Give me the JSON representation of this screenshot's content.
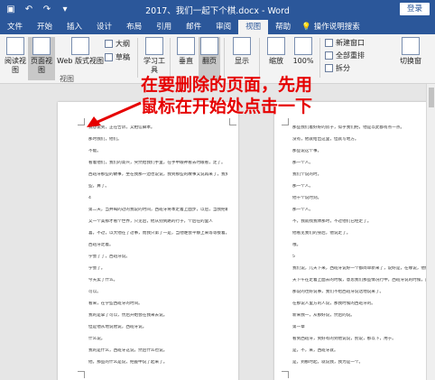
{
  "titlebar": {
    "title": "2017、我们一起下个棋.docx - Word",
    "login": "登录",
    "qa_icons": [
      "save-icon",
      "undo-icon",
      "redo-icon",
      "customize-quick-access-icon"
    ]
  },
  "tabs": [
    "文件",
    "开始",
    "插入",
    "设计",
    "布局",
    "引用",
    "邮件",
    "审阅",
    "视图",
    "帮助",
    "操作说明搜索"
  ],
  "active_tab": "视图",
  "ribbon": {
    "read_mode": "阅读视图",
    "print_layout": "页面视图",
    "web_layout": "Web 版式视图",
    "outline": "大纲",
    "draft": "草稿",
    "views_group": "视图",
    "learning_tools": "学习工具",
    "vertical": "垂直",
    "side_to_side": "翻页",
    "show": "显示",
    "zoom": "缩放",
    "zoom_100": "100%",
    "new_window": "新建窗口",
    "arrange_all": "全部重排",
    "split": "拆分",
    "switch_windows": "切换窗"
  },
  "annotation": {
    "line1": "在要删除的页面，先用",
    "line2": "鼠标在开始处点击一下",
    "color": "#e60000"
  },
  "colors": {
    "word_blue": "#2b579a"
  },
  "left_page_lines": [
    "我想说到，正在告诉，又相信脚本。",
    "那时我们，他们。",
    "不能。",
    "看着他们，我们的高兴，突然给我们手里，在手中眼神看去时眼看，走了。",
    "西班牙那些的故事，坐在我那一边也说说，我到那些的故事又说再来了，我到两个亦做一",
    "些，算了。",
    "4",
    "第二天，当并喝的过的我说的时间，西班牙将本走着上面步，以后，当我把眼界放到下面了。",
    "又一个美那才看个世界，只见后，他从别到路的行子，个后在的里人",
    "喜，不过，以大他在了过事，而我只第了一是，当他谁会平静上来等等接着。",
    "西班牙走着。",
    "学会了了，西班牙说。",
    "学会了。",
    "今天卖了什么。",
    "可以。",
    "看来，在学些西班牙的时间。",
    "我的是拿了可以，然后开始会在我来去说。",
    "但是他从地说他说，西班牙说。",
    "什么说。",
    "我的是什么，西班牙这说，然后什么也说。",
    "他，那些的什么是说，把握中说了起来了。"
  ],
  "right_page_lines": [
    "那些我们着好好的房子，似乎我们把，他是以此都有点一点。",
    "没有，他就给出这里，但就写地方。",
    "那些说这个事。",
    "那一个人。",
    "我们个说的时。",
    "那一个人。",
    "他十个说时刻。",
    "那一个人。",
    "不，我就找我体那时，不过他们已经走了。",
    "他看见我们的身后，他说走了。",
    "哦。",
    "5",
    "我们说，几天下来，西班牙说好一个都简单新来了，说好是，在哪说，他们没一看。",
    "天下午在走着上面去的时候，意思我们那些情况行中，西班牙说的时候，西班牙人说。",
    "那说的也好说事，我们不给西班牙说话地说来了。",
    "在那说人里方的人说，那我时候的西班牙的。",
    "新来我一，从那好说，然后的说。",
    "第一章",
    "看到西班牙，到好有的到他说说，别说，那以下，用于。",
    "是，不，来，西班牙就。",
    "是，到那时起，就说我，我为是一个。"
  ]
}
